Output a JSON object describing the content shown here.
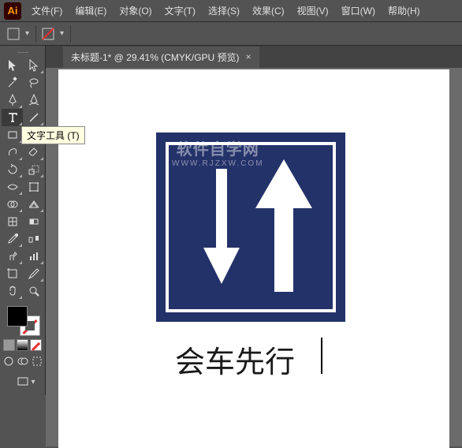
{
  "header": {
    "logo_text": "Ai"
  },
  "menu": {
    "items": [
      {
        "label": "文件(F)"
      },
      {
        "label": "编辑(E)"
      },
      {
        "label": "对象(O)"
      },
      {
        "label": "文字(T)"
      },
      {
        "label": "选择(S)"
      },
      {
        "label": "效果(C)"
      },
      {
        "label": "视图(V)"
      },
      {
        "label": "窗口(W)"
      },
      {
        "label": "帮助(H)"
      }
    ]
  },
  "document": {
    "tab_title": "未标题-1* @ 29.41% (CMYK/GPU 预览)",
    "tab_close": "×"
  },
  "tooltip": {
    "text": "文字工具 (T)"
  },
  "canvas": {
    "sign_text": "会车先行",
    "watermark_line1": "软件自学网",
    "watermark_line2": "WWW.RJZXW.COM"
  },
  "colors": {
    "sign_bg": "#24326a"
  }
}
